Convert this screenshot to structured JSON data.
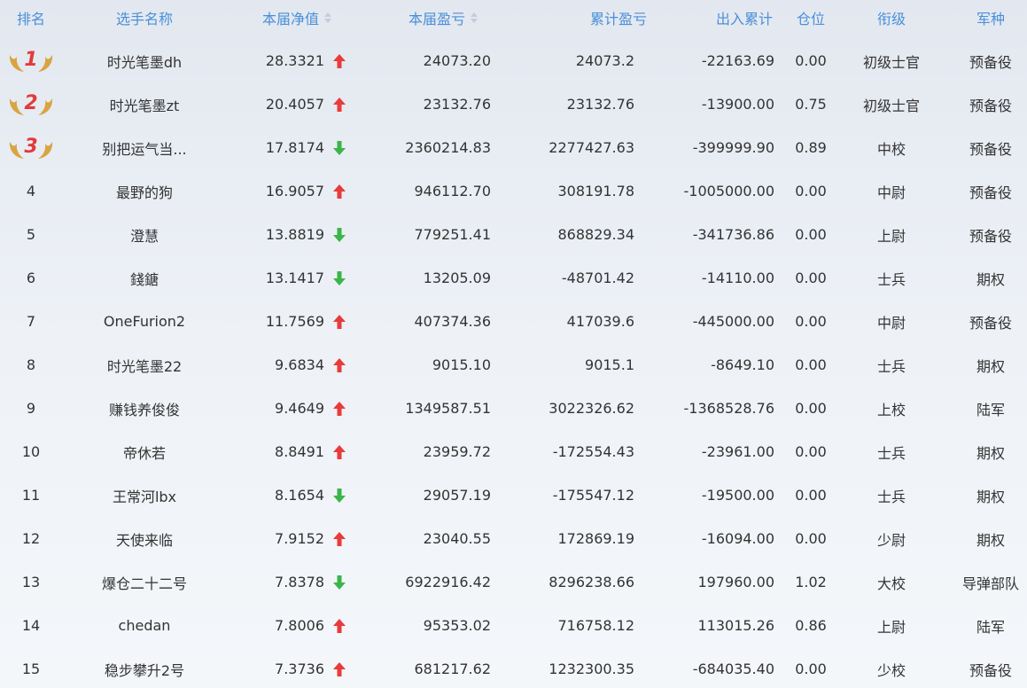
{
  "header": {
    "rank": "排名",
    "name": "选手名称",
    "nav": "本届净值",
    "pnl": "本届盈亏",
    "cum": "累计盈亏",
    "flow": "出入累计",
    "position": "仓位",
    "title": "衔级",
    "arm": "军种"
  },
  "colors": {
    "up": "#e83b3b",
    "down": "#3bb54a",
    "header": "#4a90d9",
    "medal": "#d9a441",
    "medal_number": "#e23b3b"
  },
  "rows": [
    {
      "rank": "1",
      "name": "时光笔墨dh",
      "nav": "28.3321",
      "trend": "up",
      "pnl": "24073.20",
      "cum": "24073.2",
      "flow": "-22163.69",
      "position": "0.00",
      "title": "初级士官",
      "arm": "预备役"
    },
    {
      "rank": "2",
      "name": "时光笔墨zt",
      "nav": "20.4057",
      "trend": "up",
      "pnl": "23132.76",
      "cum": "23132.76",
      "flow": "-13900.00",
      "position": "0.75",
      "title": "初级士官",
      "arm": "预备役"
    },
    {
      "rank": "3",
      "name": "别把运气当...",
      "nav": "17.8174",
      "trend": "down",
      "pnl": "2360214.83",
      "cum": "2277427.63",
      "flow": "-399999.90",
      "position": "0.89",
      "title": "中校",
      "arm": "预备役"
    },
    {
      "rank": "4",
      "name": "最野的狗",
      "nav": "16.9057",
      "trend": "up",
      "pnl": "946112.70",
      "cum": "308191.78",
      "flow": "-1005000.00",
      "position": "0.00",
      "title": "中尉",
      "arm": "预备役"
    },
    {
      "rank": "5",
      "name": "澄慧",
      "nav": "13.8819",
      "trend": "down",
      "pnl": "779251.41",
      "cum": "868829.34",
      "flow": "-341736.86",
      "position": "0.00",
      "title": "上尉",
      "arm": "预备役"
    },
    {
      "rank": "6",
      "name": "錢鎕",
      "nav": "13.1417",
      "trend": "down",
      "pnl": "13205.09",
      "cum": "-48701.42",
      "flow": "-14110.00",
      "position": "0.00",
      "title": "士兵",
      "arm": "期权"
    },
    {
      "rank": "7",
      "name": "OneFurion2",
      "nav": "11.7569",
      "trend": "up",
      "pnl": "407374.36",
      "cum": "417039.6",
      "flow": "-445000.00",
      "position": "0.00",
      "title": "中尉",
      "arm": "预备役"
    },
    {
      "rank": "8",
      "name": "时光笔墨22",
      "nav": "9.6834",
      "trend": "up",
      "pnl": "9015.10",
      "cum": "9015.1",
      "flow": "-8649.10",
      "position": "0.00",
      "title": "士兵",
      "arm": "期权"
    },
    {
      "rank": "9",
      "name": "赚钱养俊俊",
      "nav": "9.4649",
      "trend": "up",
      "pnl": "1349587.51",
      "cum": "3022326.62",
      "flow": "-1368528.76",
      "position": "0.00",
      "title": "上校",
      "arm": "陆军"
    },
    {
      "rank": "10",
      "name": "帝休若",
      "nav": "8.8491",
      "trend": "up",
      "pnl": "23959.72",
      "cum": "-172554.43",
      "flow": "-23961.00",
      "position": "0.00",
      "title": "士兵",
      "arm": "期权"
    },
    {
      "rank": "11",
      "name": "王常河lbx",
      "nav": "8.1654",
      "trend": "down",
      "pnl": "29057.19",
      "cum": "-175547.12",
      "flow": "-19500.00",
      "position": "0.00",
      "title": "士兵",
      "arm": "期权"
    },
    {
      "rank": "12",
      "name": "天使来临",
      "nav": "7.9152",
      "trend": "up",
      "pnl": "23040.55",
      "cum": "172869.19",
      "flow": "-16094.00",
      "position": "0.00",
      "title": "少尉",
      "arm": "期权"
    },
    {
      "rank": "13",
      "name": "爆仓二十二号",
      "nav": "7.8378",
      "trend": "down",
      "pnl": "6922916.42",
      "cum": "8296238.66",
      "flow": "197960.00",
      "position": "1.02",
      "title": "大校",
      "arm": "导弹部队"
    },
    {
      "rank": "14",
      "name": "chedan",
      "nav": "7.8006",
      "trend": "up",
      "pnl": "95353.02",
      "cum": "716758.12",
      "flow": "113015.26",
      "position": "0.86",
      "title": "上尉",
      "arm": "陆军"
    },
    {
      "rank": "15",
      "name": "稳步攀升2号",
      "nav": "7.3736",
      "trend": "up",
      "pnl": "681217.62",
      "cum": "1232300.35",
      "flow": "-684035.40",
      "position": "0.00",
      "title": "少校",
      "arm": "预备役"
    }
  ]
}
